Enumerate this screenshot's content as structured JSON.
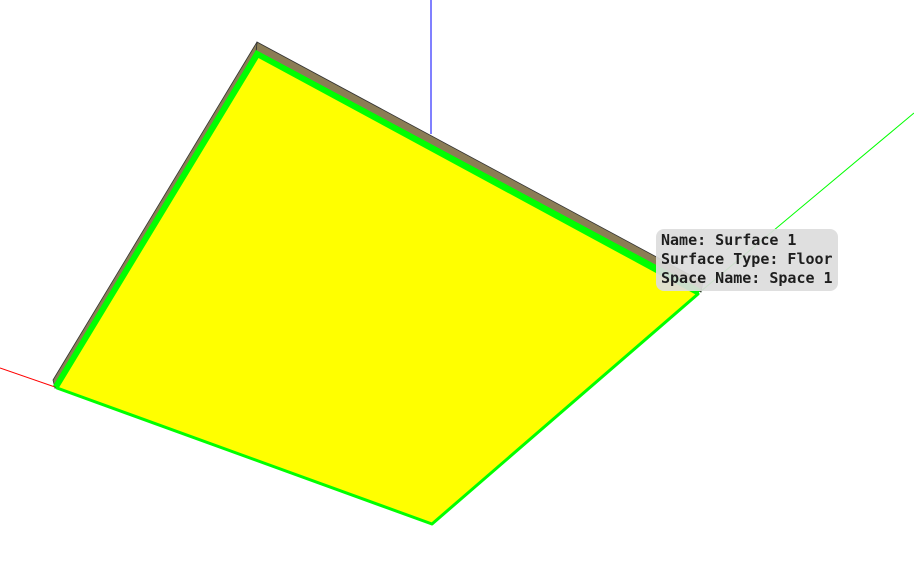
{
  "scene": {
    "background_color": "#ffffff",
    "axes": {
      "x_color": "#ff0000",
      "y_color": "#00ff00",
      "z_color": "#0000ff"
    },
    "surface": {
      "fill_color": "#ffff00",
      "edge_color": "#00ff00",
      "side_color": "#8b7d55",
      "outline_color": "#333333"
    }
  },
  "tooltip": {
    "name_line": "Name: Surface 1",
    "type_line": "Surface Type: Floor",
    "space_line": "Space Name: Space 1"
  }
}
